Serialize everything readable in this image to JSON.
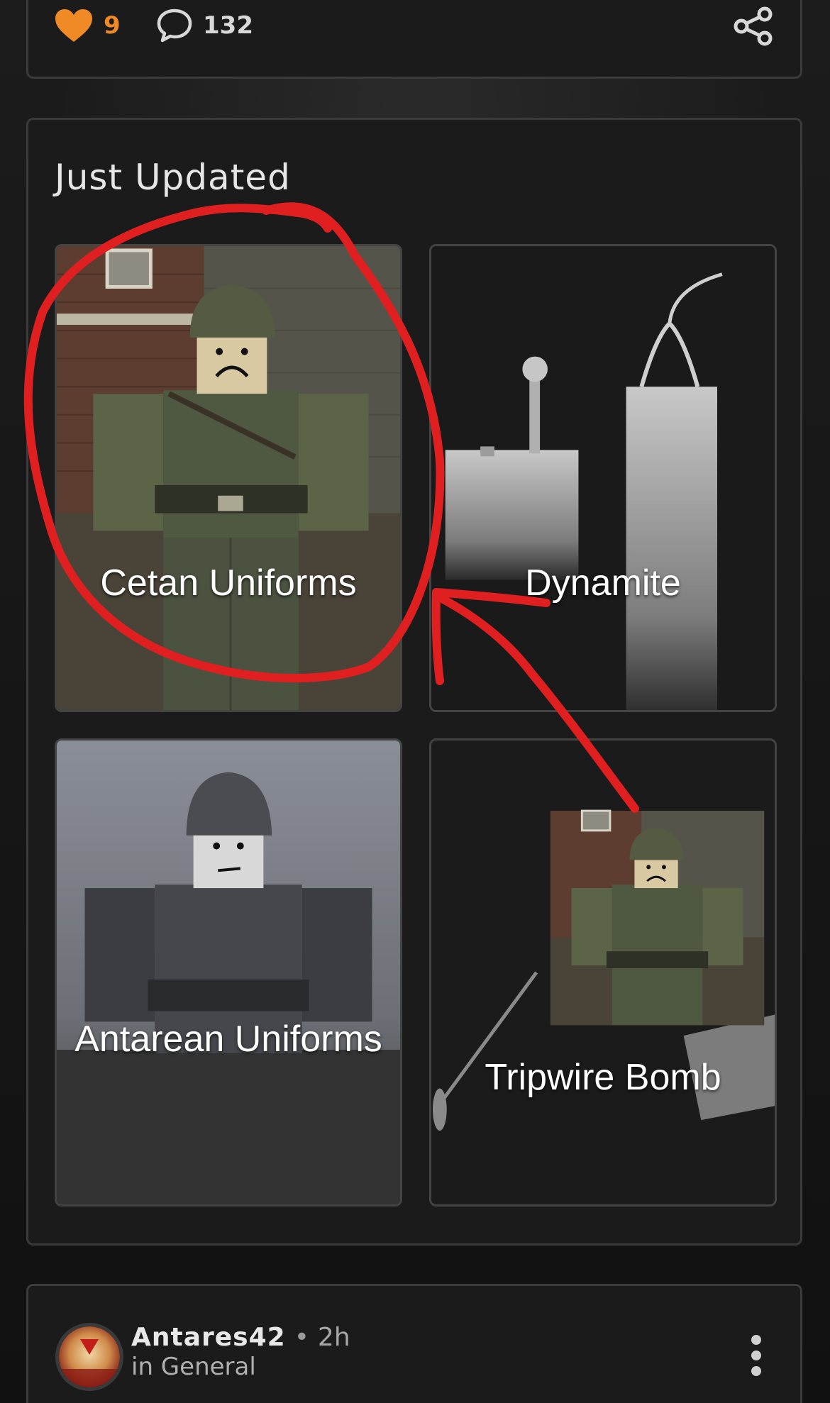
{
  "actions": {
    "likes_count": "9",
    "comments_count": "132",
    "like_icon": "heart-icon",
    "comment_icon": "speech-bubble-icon",
    "share_icon": "share-icon",
    "like_color": "#f08a24"
  },
  "section": {
    "title": "Just Updated",
    "tiles": [
      {
        "label": "Cetan Uniforms"
      },
      {
        "label": "Dynamite"
      },
      {
        "label": "Antarean Uniforms"
      },
      {
        "label": "Tripwire Bomb"
      }
    ]
  },
  "post": {
    "author": "Antares42",
    "separator": "•",
    "time": "2h",
    "community": "in General",
    "more_icon": "kebab-menu-icon"
  },
  "annotation": {
    "color": "#e02020",
    "shapes": [
      "circle-around-cetan-uniforms",
      "arrow-to-cetan-uniforms"
    ]
  }
}
